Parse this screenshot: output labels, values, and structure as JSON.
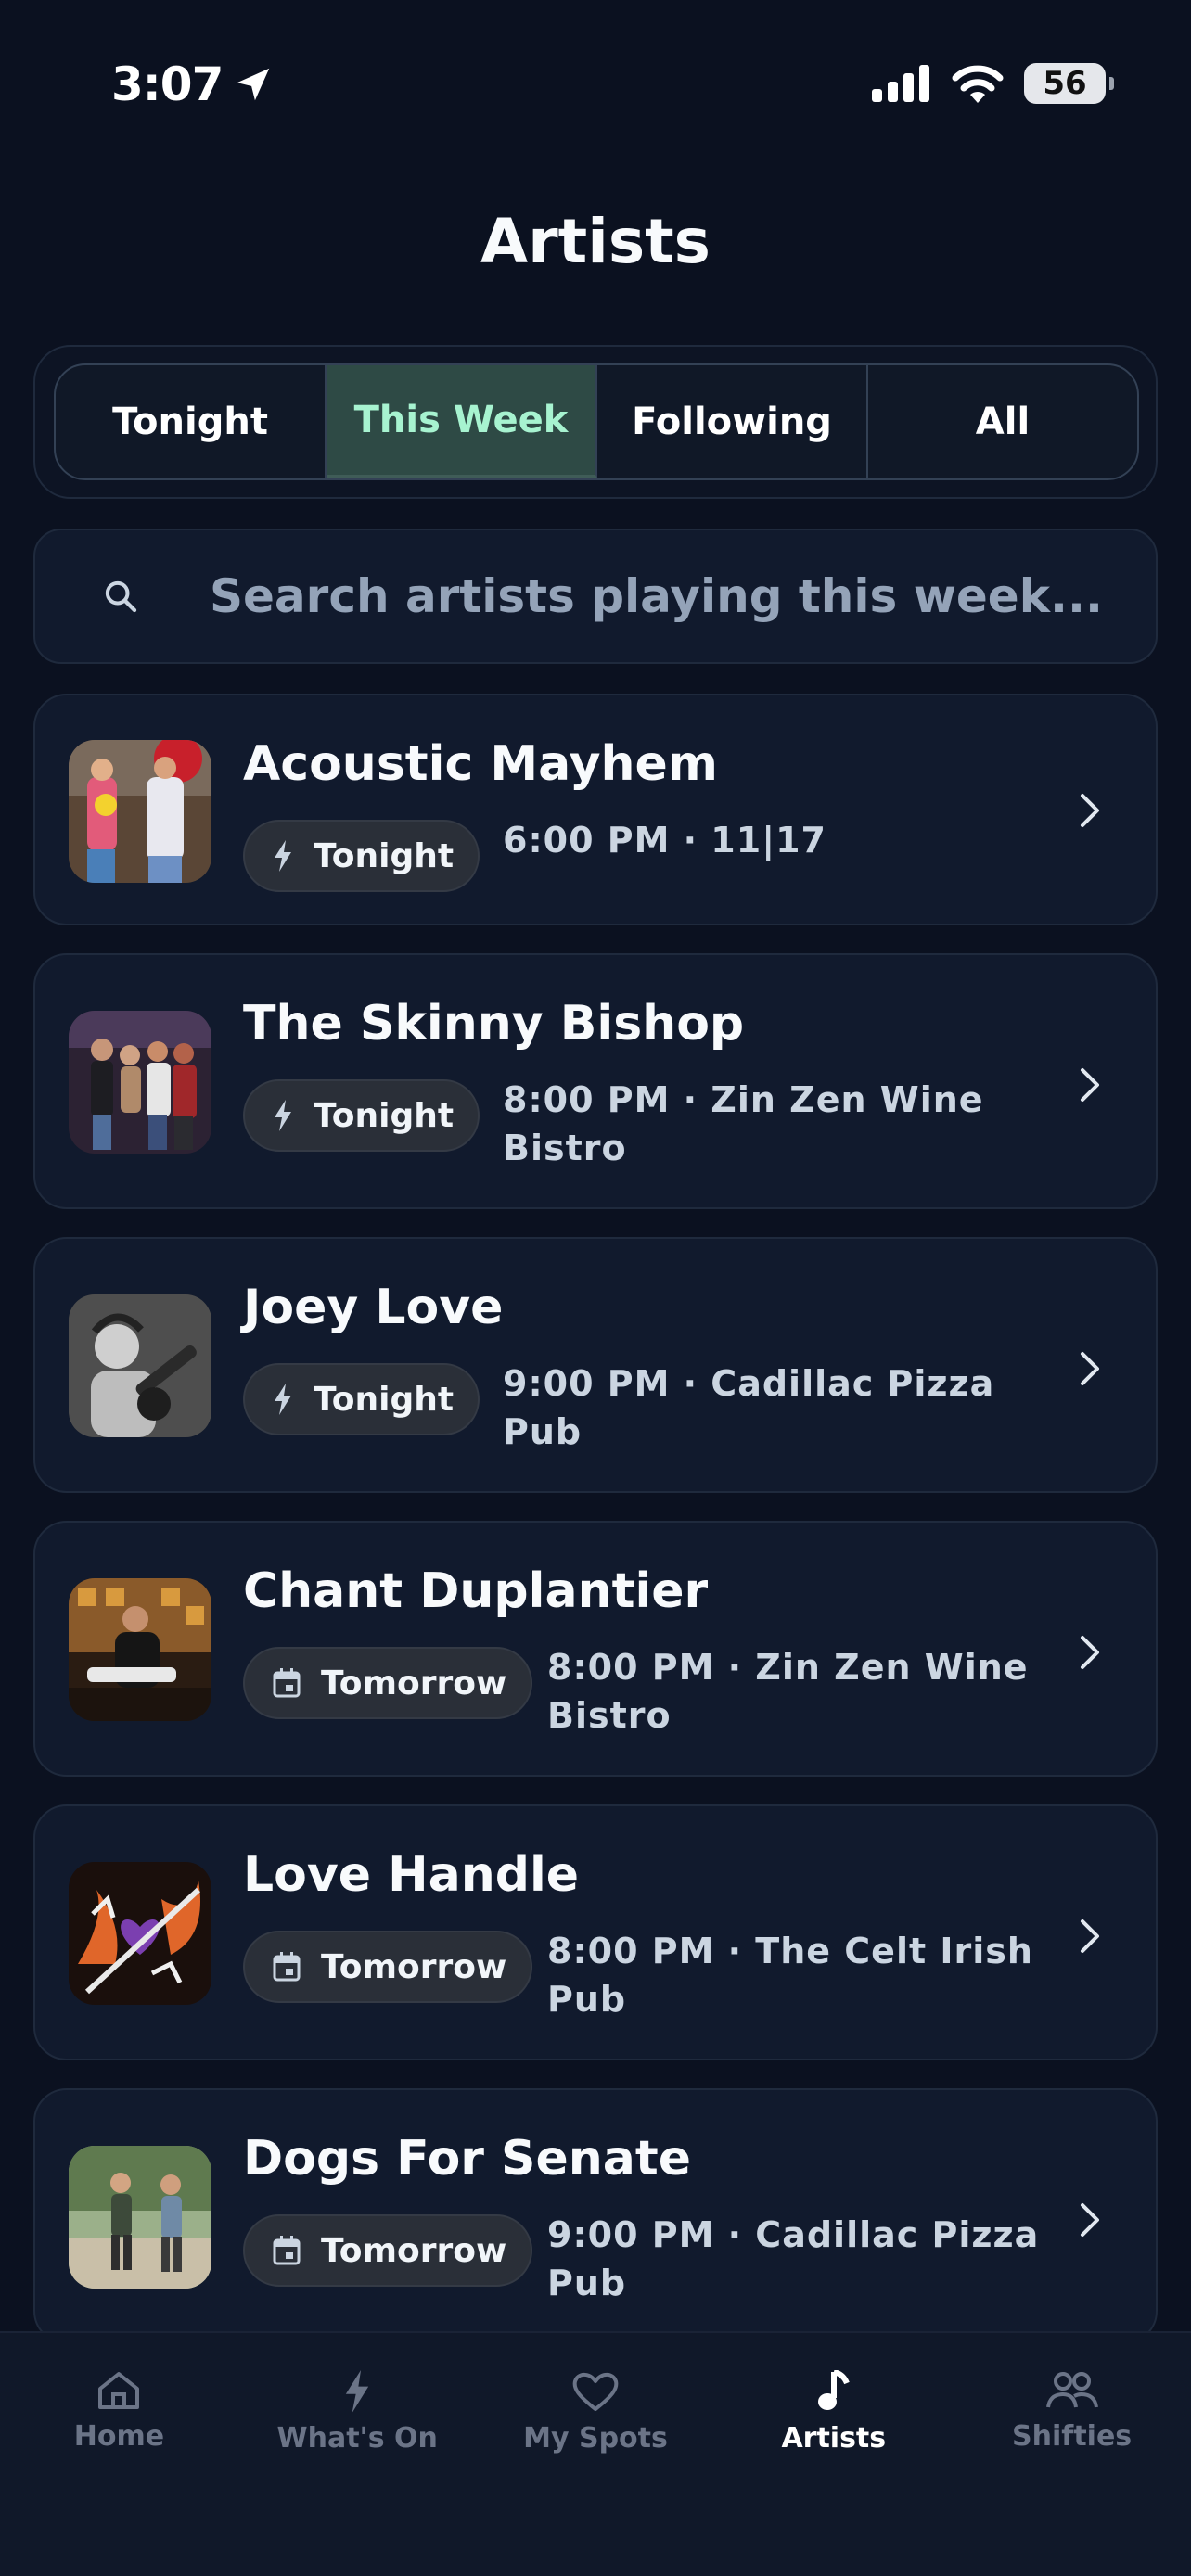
{
  "status": {
    "time": "3:07",
    "battery": "56"
  },
  "title": "Artists",
  "segments": [
    {
      "label": "Tonight",
      "active": false
    },
    {
      "label": "This Week",
      "active": true
    },
    {
      "label": "Following",
      "active": false
    },
    {
      "label": "All",
      "active": false
    }
  ],
  "search": {
    "placeholder": "Search artists playing this week..."
  },
  "artists": [
    {
      "name": "Acoustic Mayhem",
      "when": "Tonight",
      "when_icon": "bolt-icon",
      "detail": "6:00 PM · 11|17"
    },
    {
      "name": "The Skinny Bishop",
      "when": "Tonight",
      "when_icon": "bolt-icon",
      "detail": "8:00 PM · Zin Zen Wine Bistro"
    },
    {
      "name": "Joey Love",
      "when": "Tonight",
      "when_icon": "bolt-icon",
      "detail": "9:00 PM · Cadillac Pizza Pub"
    },
    {
      "name": "Chant Duplantier",
      "when": "Tomorrow",
      "when_icon": "calendar-icon",
      "detail": "8:00 PM · Zin Zen Wine Bistro"
    },
    {
      "name": "Love Handle",
      "when": "Tomorrow",
      "when_icon": "calendar-icon",
      "detail": "8:00 PM · The Celt Irish Pub"
    },
    {
      "name": "Dogs For Senate",
      "when": "Tomorrow",
      "when_icon": "calendar-icon",
      "detail": "9:00 PM · Cadillac Pizza Pub"
    }
  ],
  "tabs": [
    {
      "label": "Home",
      "icon": "home-icon",
      "active": false
    },
    {
      "label": "What's On",
      "icon": "bolt-icon",
      "active": false
    },
    {
      "label": "My Spots",
      "icon": "heart-icon",
      "active": false
    },
    {
      "label": "Artists",
      "icon": "music-note-icon",
      "active": true
    },
    {
      "label": "Shifties",
      "icon": "people-icon",
      "active": false
    }
  ],
  "colors": {
    "accent_bg": "#2e4a45",
    "accent_text": "#a7f3d0",
    "background": "#0b1120",
    "card": "#111a2d"
  }
}
